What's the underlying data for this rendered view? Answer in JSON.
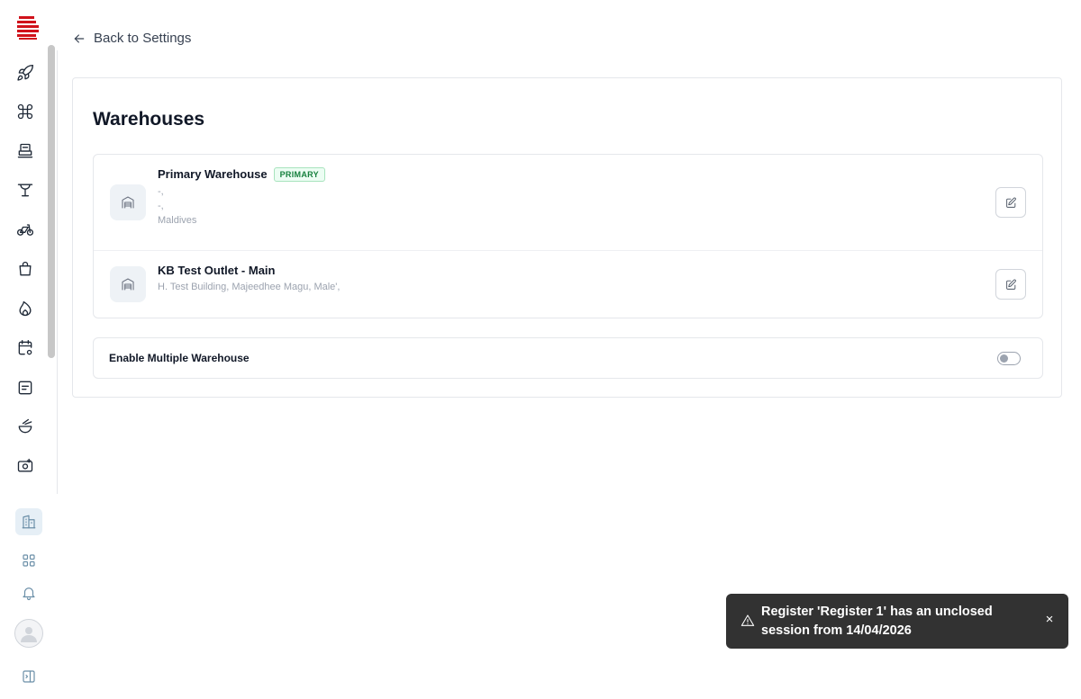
{
  "navigation": {
    "back_label": "Back to Settings"
  },
  "sidebar": {
    "nav_icons": [
      "rocket-icon",
      "command-icon",
      "register-icon",
      "table-icon",
      "bicycle-icon",
      "bag-icon",
      "flame-icon",
      "calendar-settings-icon",
      "receipt-icon",
      "food-bowl-icon",
      "camera-plus-icon"
    ],
    "bottom_icons": [
      "building-icon",
      "apps-grid-icon",
      "bell-icon",
      "user-avatar",
      "sidebar-toggle-icon"
    ],
    "active_item": "building-icon",
    "brand_color": "#d0121b"
  },
  "page": {
    "title": "Warehouses"
  },
  "warehouses": [
    {
      "name": "Primary Warehouse",
      "badge": "PRIMARY",
      "address_lines": [
        "-,",
        "-,",
        "Maldives"
      ]
    },
    {
      "name": "KB Test Outlet - Main",
      "badge": "",
      "address_lines": [
        "H. Test Building, Majeedhee Magu, Male',"
      ]
    }
  ],
  "settings": {
    "multiple_warehouse_label": "Enable Multiple Warehouse",
    "multiple_warehouse_enabled": false
  },
  "toast": {
    "message": "Register 'Register 1' has an unclosed session from 14/04/2026",
    "close_symbol": "×"
  },
  "colors": {
    "badge_text": "#15803d",
    "badge_bg": "#ecfdf3",
    "toast_bg": "#323232",
    "active_nav_bg": "#e6eff6"
  }
}
